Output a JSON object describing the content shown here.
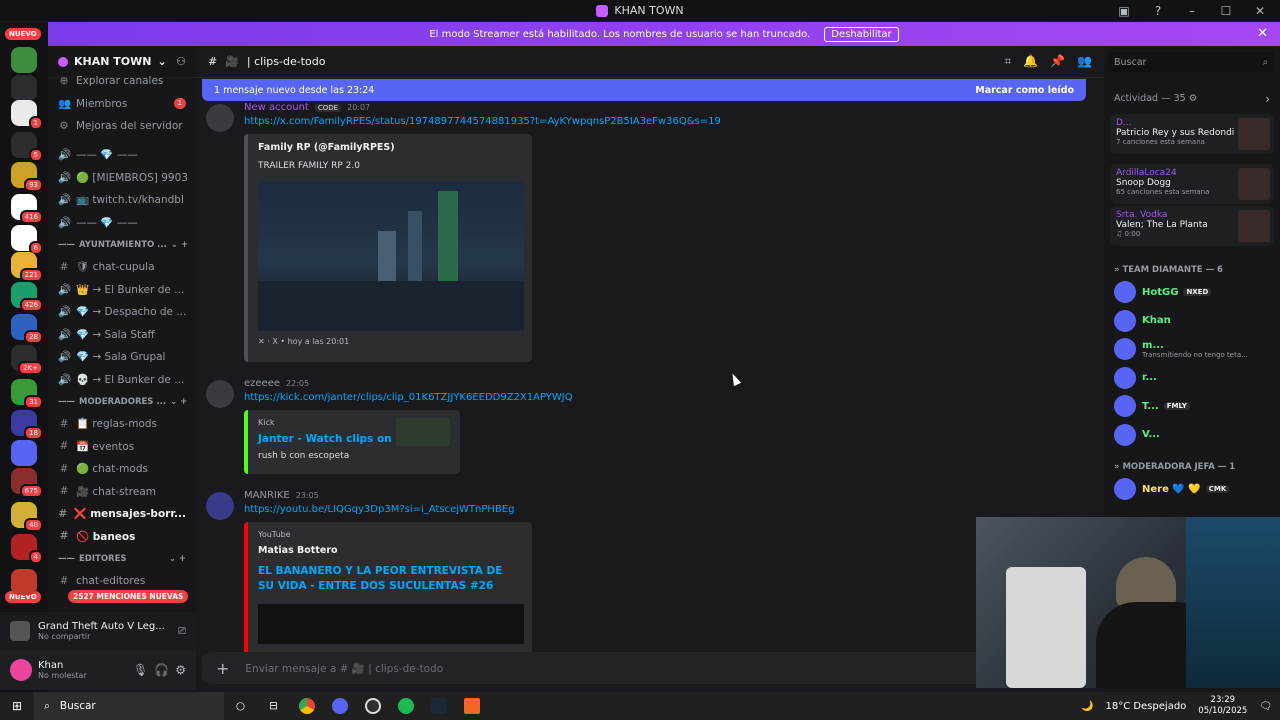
{
  "window": {
    "title": "KHAN TOWN",
    "controls": [
      "–",
      "☐",
      "✕"
    ]
  },
  "banner": {
    "text": "El modo Streamer está habilitado. Los nombres de usuario se han truncado.",
    "button": "Deshabilitar"
  },
  "guilds": {
    "nuevo_top": "NUEVO",
    "nuevo_bottom": "NUEVO",
    "badges": [
      "1",
      "5",
      "93",
      "416",
      "6",
      "221",
      "426",
      "28",
      "2K+",
      "31",
      "18",
      "675",
      "40",
      "4"
    ],
    "colors": [
      "#3d8b3d",
      "#2b2d31",
      "#eaeaea",
      "#2b2d31",
      "#c9a227",
      "#ffffff",
      "#ffffff",
      "#e8b23a",
      "#1a9e6c",
      "#3060c0",
      "#2b2d31",
      "#3a9a3a",
      "#3a3aa0",
      "#5865f2",
      "#8a2d2d",
      "#d4af37",
      "#b22222",
      "#c0392b"
    ]
  },
  "server": {
    "name": "KHAN TOWN"
  },
  "channels": {
    "top": [
      {
        "icon": "⊕",
        "label": "Explorar canales"
      },
      {
        "icon": "👥",
        "label": "Miembros",
        "badge": "1"
      },
      {
        "icon": "⚙",
        "label": "Mejoras del servidor"
      }
    ],
    "voice": [
      {
        "icon": "🔊",
        "label": "—— 💎 ——"
      },
      {
        "icon": "🔊",
        "label": "🟢 [MIEMBROS] 9903"
      },
      {
        "icon": "🔊",
        "label": "📺 twitch.tv/khandbl"
      },
      {
        "icon": "🔊",
        "label": "—— 💎 ——"
      }
    ],
    "cat1": "AYUNTAMIENTO ...",
    "cat1_channels": [
      {
        "icon": "#",
        "label": "🛡 chat-cupula"
      },
      {
        "icon": "🔊",
        "label": "👑 → El Bunker de ..."
      },
      {
        "icon": "🔊",
        "label": "💎 → Despacho de ..."
      },
      {
        "icon": "🔊",
        "label": "💎 → Sala Staff"
      },
      {
        "icon": "🔊",
        "label": "💎 → Sala Grupal"
      },
      {
        "icon": "🔊",
        "label": "💀 → El Bunker de ..."
      }
    ],
    "cat2": "MODERADORES ...",
    "cat2_channels": [
      {
        "icon": "#",
        "label": "📋 reglas-mods"
      },
      {
        "icon": "#",
        "label": "📅 eventos"
      },
      {
        "icon": "#",
        "label": "🟢 chat-mods"
      },
      {
        "icon": "#",
        "label": "🎥 chat-stream"
      },
      {
        "icon": "#",
        "label": "❌ mensajes-borr...",
        "bright": true
      },
      {
        "icon": "#",
        "label": "🚫 baneos",
        "bright": true
      }
    ],
    "cat3": "EDITORES",
    "cat3_channel": "chat-editores",
    "mentions": "2527 MENCIONES NUEVAS"
  },
  "activity_panel": {
    "game": "Grand Theft Auto V Leg...",
    "status": "No compartir"
  },
  "user": {
    "name": "Khan",
    "status": "No molestar"
  },
  "chat": {
    "channel": "clips-de-todo",
    "new_messages": "1 mensaje nuevo desde las 23:24",
    "mark_read": "Marcar como leído",
    "composer_placeholder": "Enviar mensaje a # 🎥 | clips-de-todo",
    "messages": [
      {
        "author": "New account",
        "tag": "CODE",
        "time": "20:07",
        "link": "https://x.com/FamilyRPES/status/1974897744574881935?t=AyKYwpqnsP2B5IA3eFw36Q&s=19",
        "embed": {
          "name": "Family RP (@FamilyRPES)",
          "desc": "TRAILER FAMILY RP 2.0",
          "footer": "X • hoy a las 20:01"
        }
      },
      {
        "author": "ezeeee",
        "time": "22:05",
        "link": "https://kick.com/janter/clips/clip_01K6TZJJYK6EEDD9Z2X1APYWJQ",
        "embed": {
          "provider": "Kick",
          "title": "Janter - Watch clips on Kick",
          "desc": "rush b con escopeta"
        }
      },
      {
        "author": "MANRIKE",
        "time": "23:05",
        "link": "https://youtu.be/LIQGqy3Dp3M?si=i_AtscejWTnPHBEg",
        "embed": {
          "provider": "YouTube",
          "name": "Matias Bottero",
          "title": "EL BANANERO Y LA PEOR ENTREVISTA DE SU VIDA - ENTRE DOS SUCULENTAS #26"
        }
      }
    ]
  },
  "members": {
    "search_placeholder": "Buscar",
    "activity_title": "Actividad — 35",
    "activity": [
      {
        "user": "D...",
        "track": "Patricio Rey y sus Redondit...",
        "sub": "7 canciones esta semana"
      },
      {
        "user": "ArdillaLoca24",
        "track": "Snoop Dogg",
        "sub": "65 canciones esta semana"
      },
      {
        "user": "Srta. Vodka",
        "track": "Valen; The La Planta",
        "sub": "♫ 0:00"
      }
    ],
    "role1": "TEAM DIAMANTE — 6",
    "role1_members": [
      {
        "name": "HotGG",
        "tag": "NXED",
        "color": "#57f287"
      },
      {
        "name": "Khan",
        "color": "#57f287"
      },
      {
        "name": "m...",
        "sub": "Transmitiendo no tengo teta...",
        "color": "#57f287"
      },
      {
        "name": "r...",
        "color": "#57f287"
      },
      {
        "name": "T...",
        "tag": "FMLY",
        "color": "#57f287"
      },
      {
        "name": "V...",
        "color": "#57f287"
      }
    ],
    "role2": "MODERADORA JEFA — 1",
    "role2_members": [
      {
        "name": "Nere 💙 💛",
        "tag": "CMK",
        "color": "#fee75c"
      }
    ]
  },
  "taskbar": {
    "search": "Buscar",
    "weather": "18°C  Despejado",
    "time": "23:29",
    "date": "05/10/2025"
  }
}
